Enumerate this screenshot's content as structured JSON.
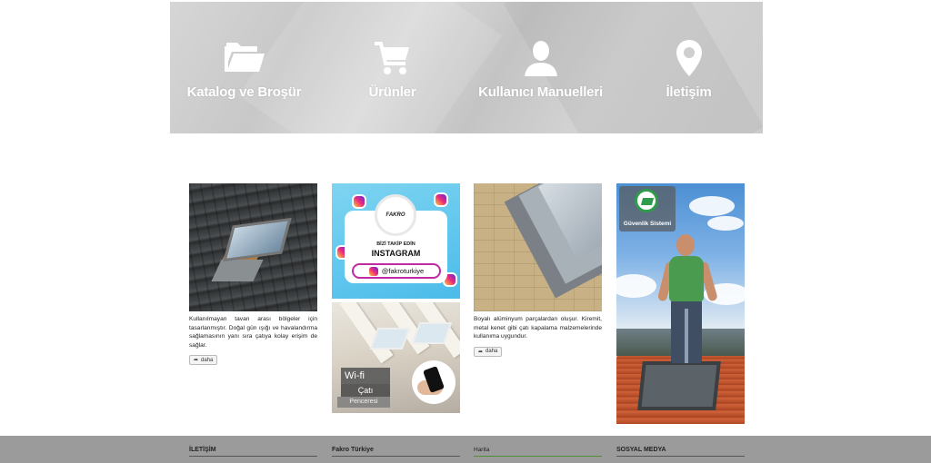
{
  "nav": [
    {
      "label": "Katalog ve Broşür",
      "icon": "folder-open-icon"
    },
    {
      "label": "Ürünler",
      "icon": "shopping-cart-icon"
    },
    {
      "label": "Kullanıcı Manuelleri",
      "icon": "user-icon"
    },
    {
      "label": "İletişim",
      "icon": "map-marker-icon"
    }
  ],
  "cards": {
    "roof_window": {
      "description": "Kullanılmayan tavan arası bölgeler için tasarlanmıştır. Doğal gün ışığı ve havalandırma sağlamasının yanı sıra çatıya kolay erişim de sağlar.",
      "more_label": "daha"
    },
    "instagram": {
      "brand": "FAKRO",
      "line1": "BİZİ TAKİP EDİN",
      "line2": "INSTAGRAM",
      "handle": "@fakroturkiye"
    },
    "wifi": {
      "line1": "Wi-fi",
      "line2": "Çatı",
      "line3": "Penceresi"
    },
    "flashing": {
      "description": "Boyalı alüminyum parçalardan oluşur. Kiremit, metal kenet gibi çatı kapalama malzemelerinde kullanıma uygundur.",
      "more_label": "daha"
    },
    "safety": {
      "badge_label": "Güvenlik Sistemi"
    }
  },
  "footer": {
    "col1": "İLETİŞİM",
    "col2": "Fakro Türkiye",
    "col3": "Harita",
    "col4": "SOSYAL MEDYA"
  },
  "colors": {
    "banner": "#cfcfcf",
    "footer": "#9b9b9b",
    "nav_text": "#ffffff"
  }
}
